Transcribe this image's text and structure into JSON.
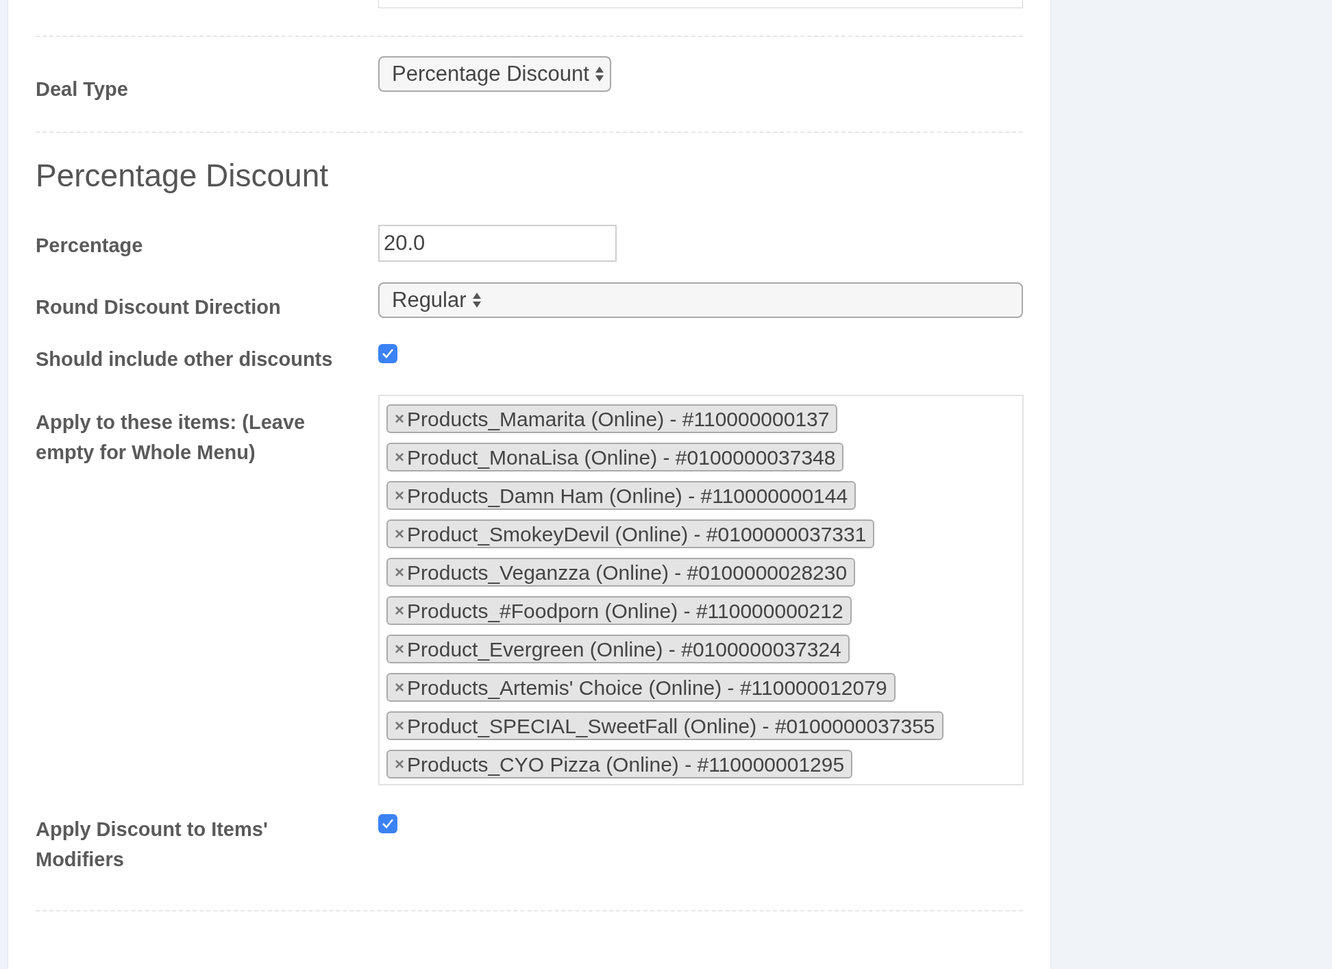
{
  "deal_type": {
    "label": "Deal Type",
    "value": "Percentage Discount"
  },
  "section_title": "Percentage Discount",
  "fields": [
    {
      "kind": "text",
      "label": "Percentage",
      "value": "20.0"
    },
    {
      "kind": "select",
      "label": "Round Discount Direction",
      "value": "Regular"
    },
    {
      "kind": "checkbox",
      "label": "Should include other discounts",
      "checked": true
    },
    {
      "kind": "tags",
      "label": "Apply to these items: (Leave empty for Whole Menu)",
      "remove_symbol": "×",
      "tags": [
        "Products_Mamarita (Online) - #110000000137",
        "Product_MonaLisa (Online) - #0100000037348",
        "Products_Damn Ham (Online) - #110000000144",
        "Product_SmokeyDevil (Online) - #0100000037331",
        "Products_Veganzza (Online) - #0100000028230",
        "Products_#Foodporn (Online) - #110000000212",
        "Product_Evergreen (Online) - #0100000037324",
        "Products_Artemis' Choice (Online) - #110000012079",
        "Product_SPECIAL_SweetFall (Online) - #0100000037355",
        "Products_CYO Pizza (Online) - #110000001295"
      ]
    },
    {
      "kind": "checkbox",
      "label": "Apply Discount to Items' Modifiers",
      "checked": true
    }
  ]
}
